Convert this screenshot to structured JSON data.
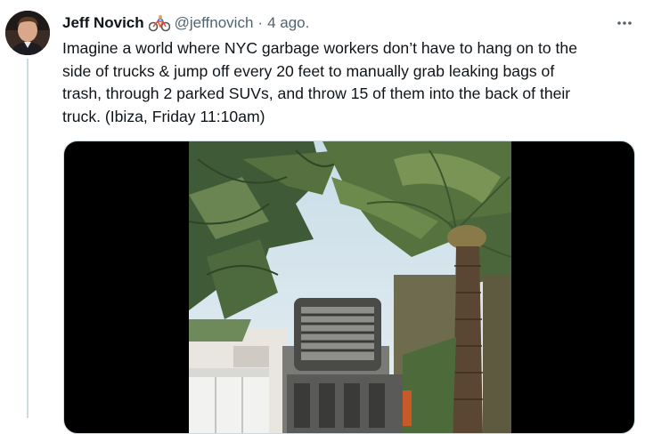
{
  "tweet": {
    "author_name": "Jeff Novich",
    "author_emoji_icon": "cyclist-icon",
    "handle": "@jeffnovich",
    "separator": "·",
    "timestamp": "4 ago.",
    "text": "Imagine a world where NYC garbage workers don’t have to hang on to the\nside of trucks & jump off every 20 feet to manually grab leaking bags of\ntrash, through 2 parked SUVs, and throw 15 of them into the back of their\ntruck. (Ibiza, Friday 11:10am)"
  },
  "icons": {
    "more": "more-options-icon"
  },
  "colors": {
    "text_primary": "#0f1419",
    "text_secondary": "#536471",
    "border": "#cfd9de"
  }
}
